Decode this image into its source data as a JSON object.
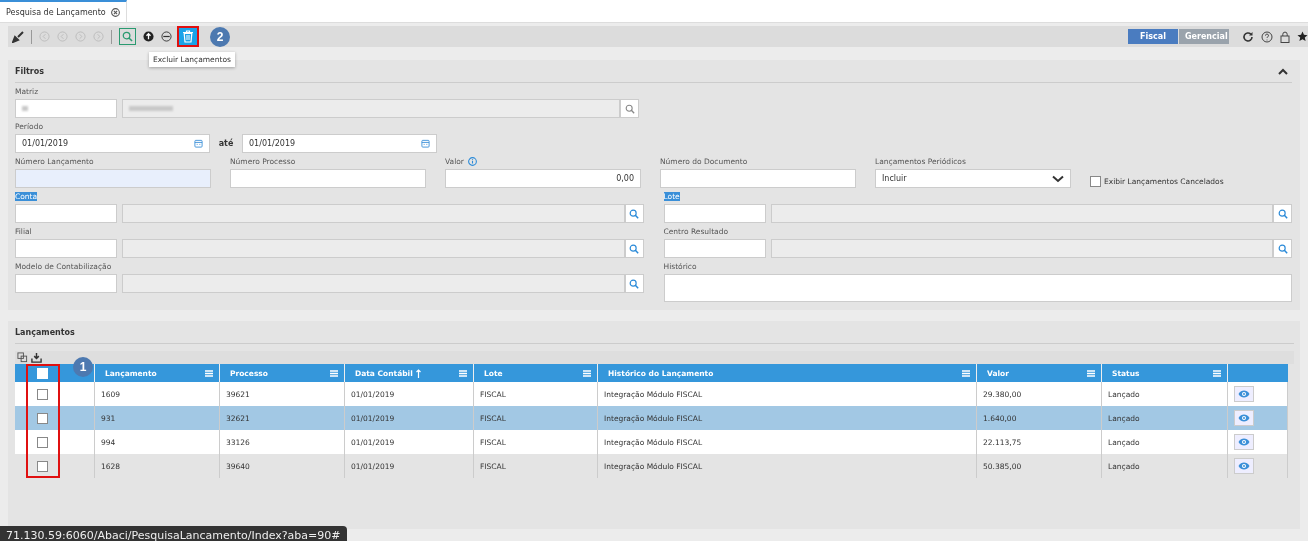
{
  "tab": {
    "label": "Pesquisa de Lançamento",
    "selected": true
  },
  "toolbar": {
    "tooltip": "Excluir Lançamentos",
    "views": [
      {
        "label": "Fiscal",
        "selected": true
      },
      {
        "label": "Gerencial",
        "selected": false
      }
    ]
  },
  "annotations": [
    "1",
    "2"
  ],
  "filters": {
    "title": "Filtros",
    "matriz": {
      "label": "Matriz"
    },
    "periodo": {
      "label": "Período",
      "from": "01/01/2019",
      "sep": "até",
      "to": "01/01/2019"
    },
    "fields": [
      {
        "label": "Número Lançamento",
        "kind": "focused"
      },
      {
        "label": "Número Processo",
        "kind": "text"
      },
      {
        "label": "Valor",
        "value": "0,00",
        "kind": "number"
      },
      {
        "label": "Número do Documento",
        "kind": "text"
      },
      {
        "label": "Lançamentos Periódicos",
        "value": "Incluir",
        "kind": "select"
      }
    ],
    "show_cancelled": {
      "label": "Exibir Lançamentos Cancelados",
      "checked": false
    },
    "lookups_left": [
      {
        "label": "Conta",
        "highlighted": true
      },
      {
        "label": "Filial",
        "highlighted": false
      },
      {
        "label": "Modelo de Contabilização",
        "highlighted": false
      }
    ],
    "lookups_right": [
      {
        "label": "Lote",
        "highlighted": true
      },
      {
        "label": "Centro Resultado",
        "highlighted": false
      }
    ],
    "historico": {
      "label": "Histórico"
    }
  },
  "table": {
    "title": "Lançamentos",
    "all_checked": false,
    "columns": [
      "Lançamento",
      "Processo",
      "Data Contábil",
      "Lote",
      "Histórico do Lançamento",
      "Valor",
      "Status"
    ],
    "rows": [
      {
        "selected": false,
        "checked": false,
        "cells": [
          "1609",
          "39621",
          "01/01/2019",
          "FISCAL",
          "Integração Módulo FISCAL",
          "29.380,00",
          "Lançado"
        ]
      },
      {
        "selected": true,
        "checked": false,
        "cells": [
          "931",
          "32621",
          "01/01/2019",
          "FISCAL",
          "Integração Módulo FISCAL",
          "1.640,00",
          "Lançado"
        ]
      },
      {
        "selected": false,
        "checked": false,
        "cells": [
          "994",
          "33126",
          "01/01/2019",
          "FISCAL",
          "Integração Módulo FISCAL",
          "22.113,75",
          "Lançado"
        ]
      },
      {
        "selected": false,
        "checked": false,
        "cells": [
          "1628",
          "39640",
          "01/01/2019",
          "FISCAL",
          "Integração Módulo FISCAL",
          "50.385,00",
          "Lançado"
        ]
      }
    ]
  },
  "status_bar": {
    "url": "71.130.59:6060/Abaci/PesquisaLancamento/Index?aba=90#"
  }
}
